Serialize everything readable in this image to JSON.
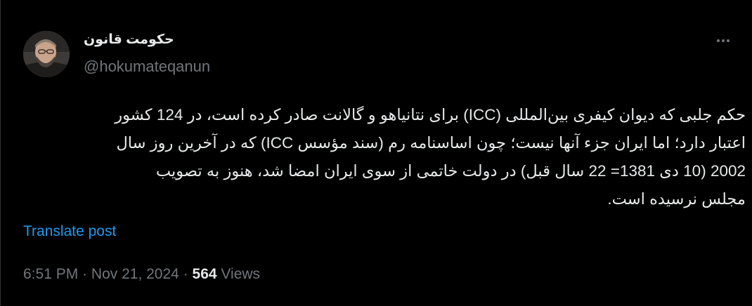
{
  "author": {
    "display_name": "حکومت قانون",
    "handle": "@hokumateqanun",
    "avatar_icon": "profile-photo"
  },
  "post": {
    "lines": [
      "حکم جلبی که دیوان کیفری بین‌المللی (ICC) برای نتانیاهو و گالانت صادر کرده است، در 124 کشور",
      "اعتبار دارد؛ اما ایران جزء آنها نیست؛ چون اساسنامه رم (سند مؤسس ICC)  که در  آخرین روز سال",
      "2002 (10 دی 1381= 22 سال قبل) در دولت خاتمی از سوی ایران امضا شد، هنوز به تصویب",
      "مجلس نرسیده است."
    ],
    "translate_label": "Translate post"
  },
  "meta": {
    "time": "6:51 PM",
    "separator": "·",
    "date": "Nov 21, 2024",
    "views_count": "564",
    "views_label": "Views"
  },
  "icons": {
    "more": "more-horizontal-icon"
  },
  "colors": {
    "background": "#000000",
    "text_primary": "#e7e9ea",
    "text_secondary": "#71767b",
    "link": "#1d9bf0"
  }
}
